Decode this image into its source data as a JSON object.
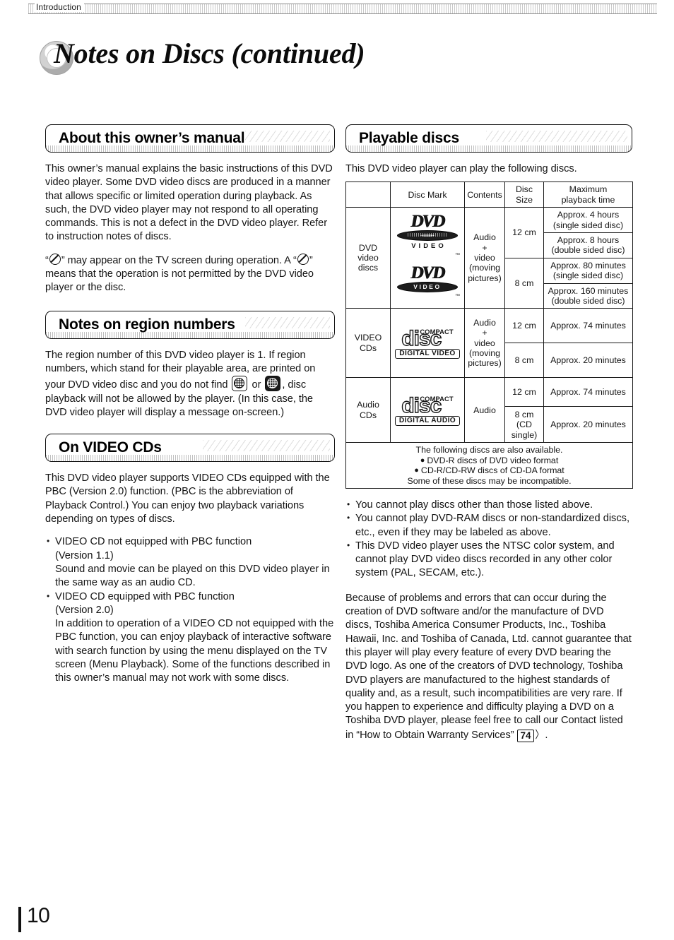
{
  "running_head": {
    "label": "Introduction"
  },
  "title": "Notes on Discs (continued)",
  "folio": "10",
  "left_column": {
    "section1": {
      "heading": "About this owner’s manual",
      "paragraph1": "This owner’s manual explains the basic instructions of this DVD video player. Some DVD video discs are produced in a manner that allows specific or limited operation during playback. As such, the DVD video player may not respond to all operating commands. This is not a defect in the DVD video player. Refer to instruction notes of discs.",
      "paragraph2_part1": "“",
      "paragraph2_part2": "” may appear on the TV screen during operation. A “",
      "paragraph2_part3": "” means that the operation is not permitted by the DVD video player or the disc."
    },
    "section2": {
      "heading": "Notes on region numbers",
      "paragraph_part1": "The region number of this DVD video player is 1. If region numbers, which stand for their playable area, are printed on your DVD video disc and you do not find",
      "paragraph_part2": "or",
      "paragraph_part3": ", disc playback will not be allowed by the player. (In this case, the DVD video player will display a message on-screen.)"
    },
    "section3": {
      "heading": "On VIDEO CDs",
      "paragraph1": "This DVD video player supports VIDEO CDs equipped with the PBC (Version 2.0) function. (PBC is the abbreviation of Playback Control.) You can enjoy two playback variations depending on types of discs.",
      "bullets": [
        {
          "line1": "VIDEO CD not equipped with PBC function",
          "line2": "(Version 1.1)",
          "body": "Sound and movie can be played on this DVD video player in the same way as an audio CD."
        },
        {
          "line1": "VIDEO CD equipped with PBC function",
          "line2": "(Version 2.0)",
          "body": "In addition to operation of a VIDEO CD not equipped with the PBC function, you can enjoy playback of interactive software with search function by using the menu displayed on the TV screen (Menu Playback). Some of the functions described in this owner’s manual may not work with some discs."
        }
      ]
    }
  },
  "right_column": {
    "section": {
      "heading": "Playable discs",
      "intro": "This DVD video player can play the following discs."
    },
    "table": {
      "headers": [
        "",
        "Disc Mark",
        "Contents",
        "Disc Size",
        "Maximum playback time"
      ],
      "rows": [
        {
          "kind": "DVD video discs",
          "mark_logos": [
            {
              "word": "DVD",
              "sub": "VIDEO",
              "style": "below"
            },
            {
              "word": "DVD",
              "sub": "VIDEO",
              "style": "inside"
            }
          ],
          "contents": "Audio + video (moving pictures)",
          "contents_lines": [
            "Audio",
            "+",
            "video",
            "(moving",
            "pictures)"
          ],
          "sizes": [
            {
              "size": "12 cm",
              "times": [
                "Approx. 4 hours (single sided disc)",
                "Approx. 8 hours (double sided disc)"
              ],
              "times_split": [
                {
                  "a": "Approx. 4 hours",
                  "b": "(single sided disc)"
                },
                {
                  "a": "Approx. 8 hours",
                  "b": "(double sided disc)"
                }
              ]
            },
            {
              "size": "8 cm",
              "times": [
                "Approx. 80 minutes (single sided disc)",
                "Approx. 160 minutes (double sided disc)"
              ],
              "times_split": [
                {
                  "a": "Approx. 80 minutes",
                  "b": "(single sided disc)"
                },
                {
                  "a": "Approx. 160 minutes",
                  "b": "(double sided disc)"
                }
              ]
            }
          ]
        },
        {
          "kind": "VIDEO CDs",
          "mark_logo": {
            "compact": "COMPACT",
            "word": "disc",
            "band": "DIGITAL VIDEO"
          },
          "contents_lines": [
            "Audio",
            "+",
            "video",
            "(moving",
            "pictures)"
          ],
          "sizes": [
            {
              "size": "12 cm",
              "time": "Approx. 74 minutes"
            },
            {
              "size": "8 cm",
              "time": "Approx. 20 minutes"
            }
          ]
        },
        {
          "kind": "Audio CDs",
          "mark_logo": {
            "compact": "COMPACT",
            "word": "disc",
            "band": "DIGITAL AUDIO"
          },
          "contents_lines": [
            "Audio"
          ],
          "sizes": [
            {
              "size": "12 cm",
              "time": "Approx. 74 minutes"
            },
            {
              "size": "8 cm (CD single)",
              "size_lines": [
                "8 cm",
                "(CD",
                "single)"
              ],
              "time": "Approx. 20 minutes"
            }
          ]
        }
      ],
      "footer_note": {
        "line1": "The following discs are also available.",
        "bullet1": "DVD-R discs of DVD video format",
        "bullet2": "CD-R/CD-RW discs of CD-DA format",
        "line2": "Some of these discs may be incompatible."
      }
    },
    "notes": [
      "You cannot play discs other than those listed above.",
      "You cannot play DVD-RAM discs or non-standardized discs, etc., even if they may be labeled as above.",
      "This DVD video player uses the NTSC color system, and cannot play DVD video discs recorded in any other color system (PAL, SECAM, etc.)."
    ],
    "disclaimer_part1": "Because of problems and errors that can occur during the creation of DVD software and/or the manufacture of DVD discs, Toshiba America Consumer Products, Inc., Toshiba Hawaii, Inc. and Toshiba of Canada, Ltd. cannot guarantee that this player will play every feature of every DVD bearing the DVD logo. As one of the creators of DVD technology, Toshiba DVD players are manufactured to the highest standards of quality and, as a result, such incompatibilities are very rare. If you happen to experience and difficulty playing a DVD on a Toshiba DVD player, please feel free to call our Contact listed in “How to Obtain Warranty Services”",
    "disclaimer_pageref": "74",
    "disclaimer_part2": "."
  }
}
